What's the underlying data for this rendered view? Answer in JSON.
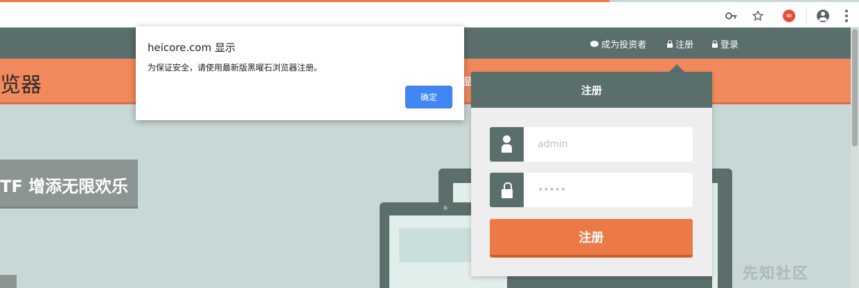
{
  "browser": {
    "icons": [
      "key-icon",
      "star-icon",
      "extension-icon",
      "profile-icon",
      "menu-icon"
    ],
    "extension_glyph": "∞"
  },
  "nav": {
    "invest_label": "成为投资者",
    "register_label": "注册",
    "login_label": "登录"
  },
  "brand": {
    "partial_title": "览器",
    "band_partial_text": "品"
  },
  "hero": {
    "banner_text": "TF 增添无限欢乐"
  },
  "register_panel": {
    "title": "注册",
    "username_placeholder": "admin",
    "password_value": "•••••",
    "submit_label": "注册"
  },
  "alert": {
    "title": "heicore.com 显示",
    "message": "为保证安全，请使用最新版黑曜石浏览器注册。",
    "ok_label": "确定"
  },
  "watermark": "先知社区",
  "colors": {
    "nav_bg": "#5a6e6c",
    "accent_orange": "#ec7a47",
    "band_orange": "#f2895c",
    "page_bg": "#c8d8d6",
    "dialog_button": "#4285f4"
  }
}
